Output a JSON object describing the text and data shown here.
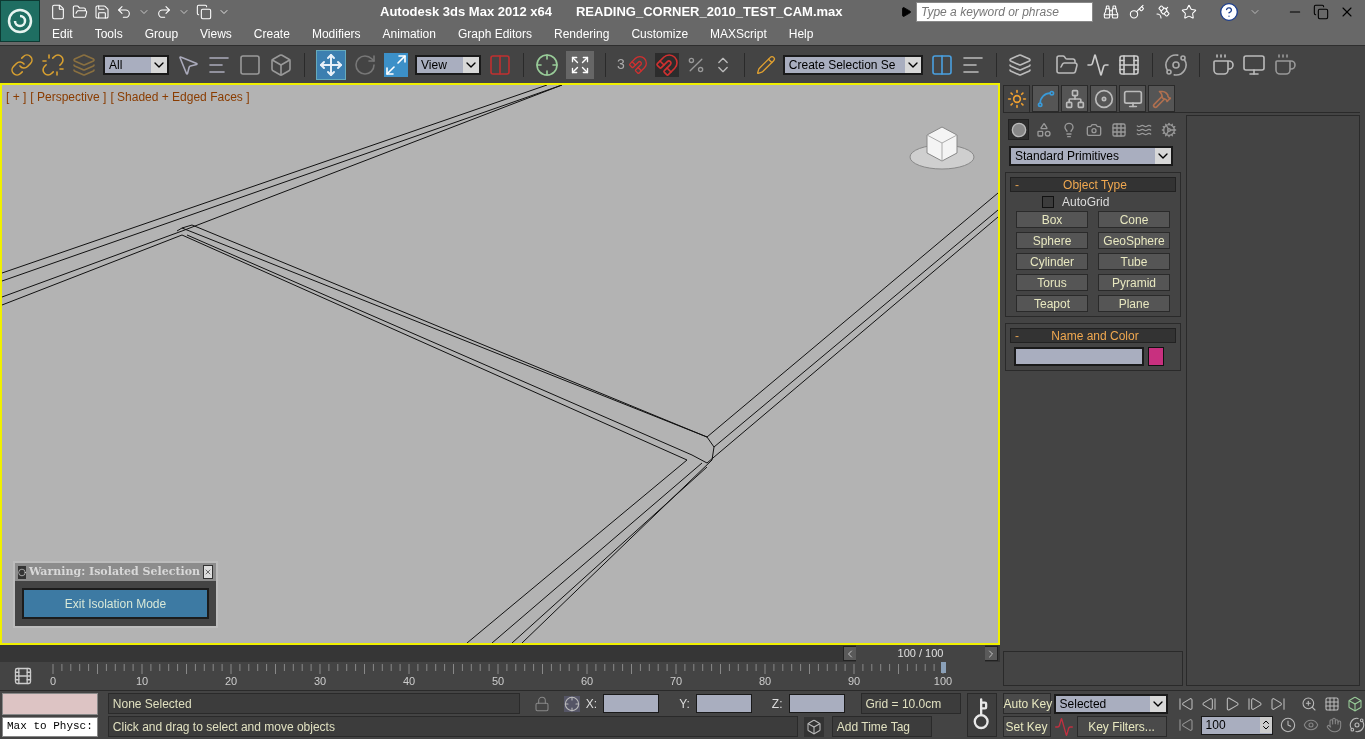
{
  "window": {
    "title": "Autodesk 3ds Max  2012 x64",
    "file": "READING_CORNER_2010_TEST_CAM.max"
  },
  "search": {
    "placeholder": "Type a keyword or phrase"
  },
  "menu": [
    "Edit",
    "Tools",
    "Group",
    "Views",
    "Create",
    "Modifiers",
    "Animation",
    "Graph Editors",
    "Rendering",
    "Customize",
    "MAXScript",
    "Help"
  ],
  "toolbar": {
    "selection_filter": "All",
    "reference_coord": "View",
    "snap_label": "3",
    "selection_set": "Create Selection Se",
    "move_selected": true
  },
  "viewport": {
    "labels": [
      "[ + ]",
      "[ Perspective ]",
      "[ Shaded + Edged Faces ]"
    ],
    "active": true
  },
  "dialog": {
    "title": "Warning: Isolated Selection",
    "button": "Exit Isolation Mode"
  },
  "command_panel": {
    "tabs": [
      {
        "kind": "create",
        "selected": true
      },
      {
        "kind": "modify",
        "selected": false
      },
      {
        "kind": "hierarchy",
        "selected": false
      },
      {
        "kind": "motion",
        "selected": false
      },
      {
        "kind": "display",
        "selected": false
      },
      {
        "kind": "utilities",
        "selected": false
      }
    ],
    "categories": [
      {
        "kind": "geometry",
        "selected": true
      },
      {
        "kind": "shapes",
        "selected": false
      },
      {
        "kind": "lights",
        "selected": false
      },
      {
        "kind": "cameras",
        "selected": false
      },
      {
        "kind": "helpers",
        "selected": false
      },
      {
        "kind": "spacewarps",
        "selected": false
      },
      {
        "kind": "systems",
        "selected": false
      }
    ],
    "dropdown": "Standard Primitives",
    "object_type": {
      "collapse": "-",
      "title": "Object Type",
      "autogrid": {
        "label": "AutoGrid",
        "checked": false
      },
      "buttons": [
        "Box",
        "Cone",
        "Sphere",
        "GeoSphere",
        "Cylinder",
        "Tube",
        "Torus",
        "Pyramid",
        "Teapot",
        "Plane"
      ]
    },
    "name_and_color": {
      "collapse": "-",
      "title": "Name and Color",
      "color": "#c8307f"
    }
  },
  "timeline": {
    "counter": "100 / 100",
    "level": 1,
    "ticks": [
      "0",
      "10",
      "20",
      "30",
      "40",
      "50",
      "60",
      "70",
      "80",
      "90",
      "100"
    ]
  },
  "status": {
    "script_listener": "Max to Physc:",
    "selection": "None Selected",
    "prompt": "Click and drag to select and move objects",
    "x_label": "X:",
    "y_label": "Y:",
    "z_label": "Z:",
    "grid": "Grid = 10.0cm",
    "time_tag": "Add Time Tag",
    "auto_key": "Auto Key",
    "set_key": "Set Key",
    "key_mode": "Selected",
    "key_filters": "Key Filters...",
    "frame": "100"
  }
}
